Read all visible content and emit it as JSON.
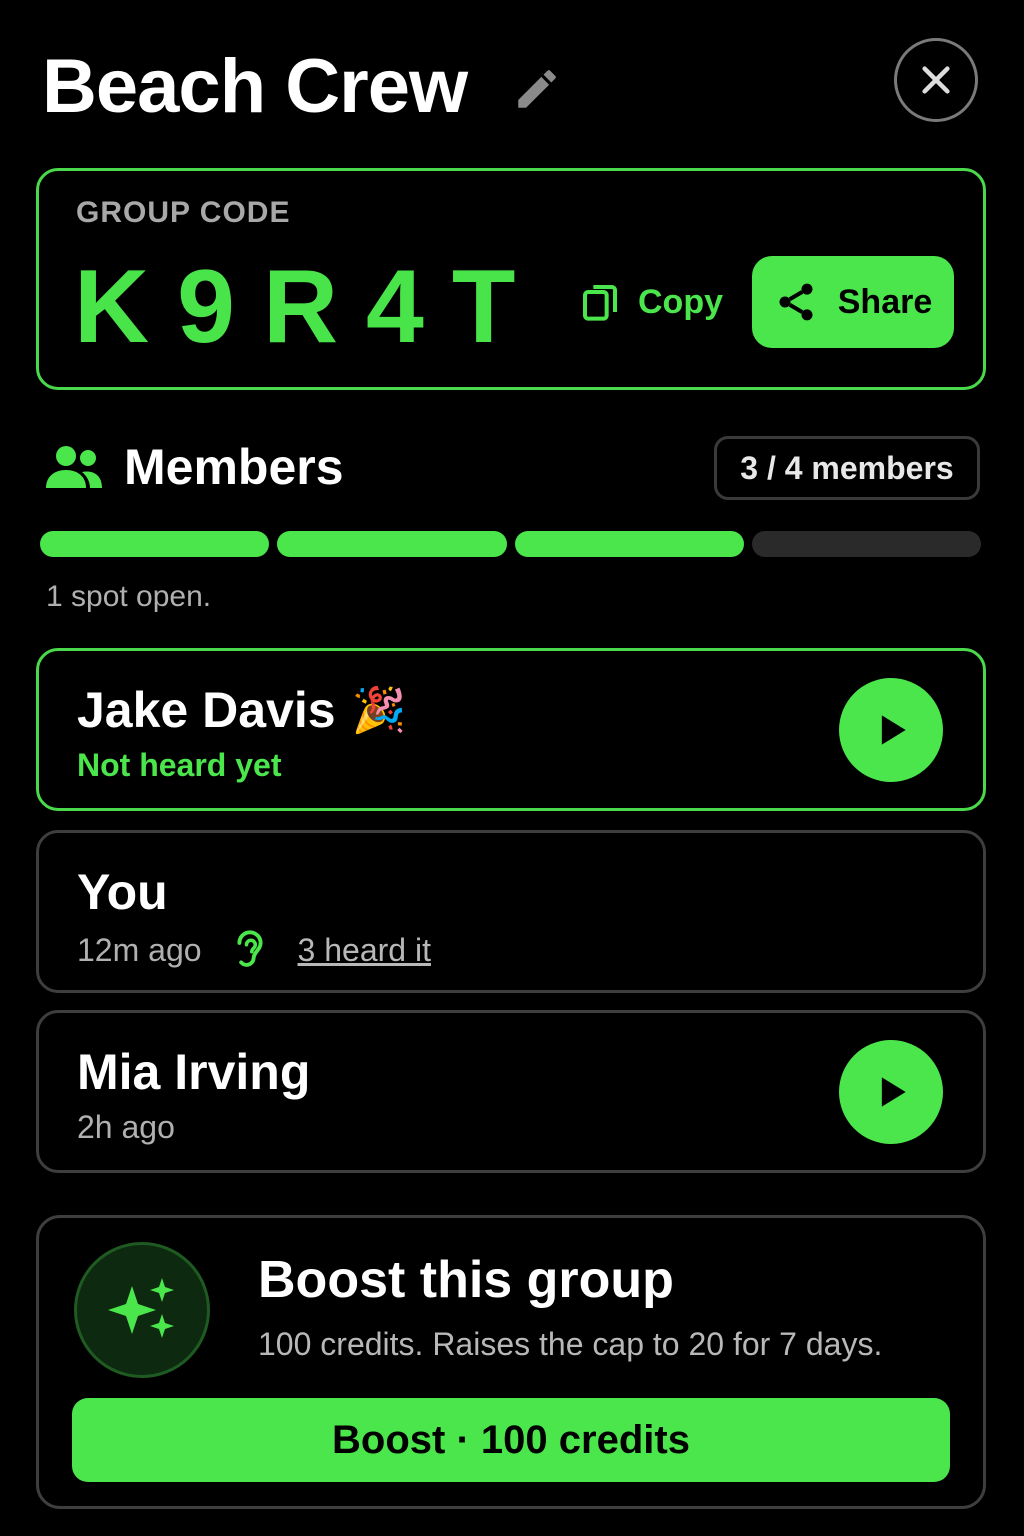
{
  "header": {
    "title": "Beach Crew",
    "edit_icon": "pencil-icon",
    "close_icon": "close-icon"
  },
  "group_code": {
    "label": "GROUP CODE",
    "code": "K9R4T",
    "copy_label": "Copy",
    "share_label": "Share"
  },
  "members": {
    "title": "Members",
    "count_text": "3 / 4 members",
    "filled": 3,
    "capacity": 4,
    "status_text": "1 spot open.",
    "list": [
      {
        "name": "Jake Davis",
        "emoji": "🎉",
        "status": "Not heard yet",
        "playable": true,
        "highlighted": true
      },
      {
        "name": "You",
        "status": "12m ago",
        "heard_text": "3 heard it",
        "playable": false,
        "highlighted": false
      },
      {
        "name": "Mia Irving",
        "status": "2h ago",
        "playable": true,
        "highlighted": false
      }
    ]
  },
  "boost": {
    "title": "Boost this group",
    "description": "100 credits. Raises the cap to 20 for 7 days.",
    "button_label": "Boost · 100 credits",
    "icon": "sparkles-icon"
  },
  "colors": {
    "accent": "#4be64c",
    "background": "#000000",
    "muted_text": "#b0b0b0",
    "border": "#3e3e3e"
  }
}
